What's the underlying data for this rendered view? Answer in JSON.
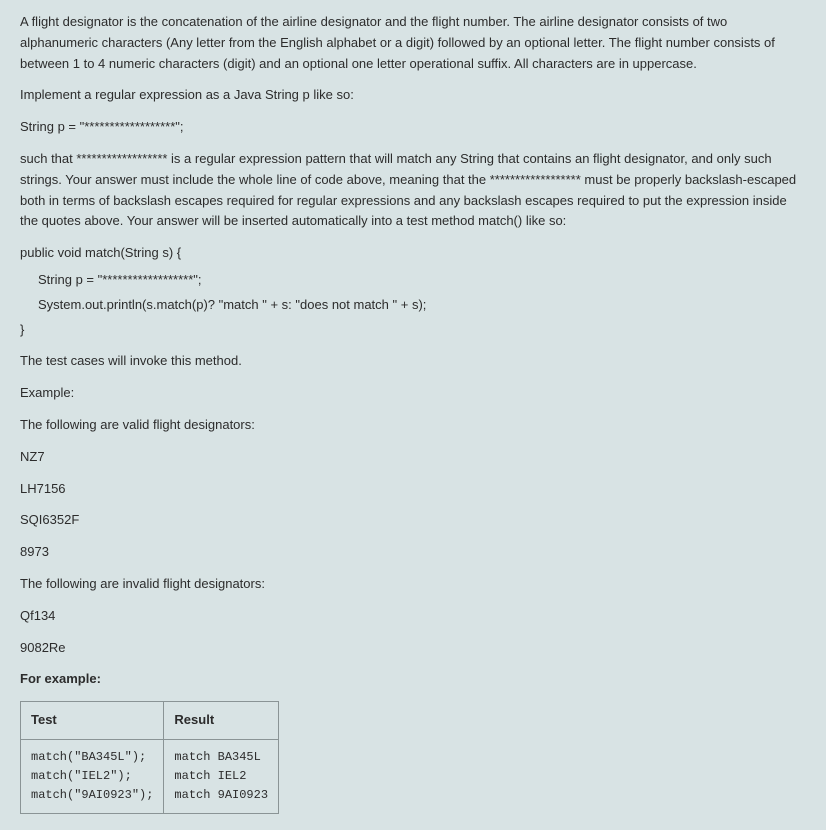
{
  "intro1": "A flight designator is the concatenation of the airline designator and the flight number.  The airline designator consists of two alphanumeric characters (Any letter from the English alphabet or a digit) followed by an optional letter.  The flight number consists of between 1 to 4 numeric characters (digit) and an optional one letter operational suffix.  All characters are in uppercase.",
  "intro2": "Implement a regular expression as a Java String p like so:",
  "codeline1": "String p = \"******************\";",
  "suchthat": "such that ****************** is a regular expression pattern that will match any String that contains an flight designator, and only such strings. Your answer must include the whole line of code above, meaning that the ****************** must be properly backslash-escaped both in terms of backslash escapes required for regular expressions and any backslash escapes required to put the expression inside the quotes above. Your answer will be inserted automatically into a test method match() like so:",
  "method_open": "public void match(String s) {",
  "method_l1": "String p = \"******************\";",
  "method_l2": "System.out.println(s.match(p)? \"match \" + s: \"does not match \" + s);",
  "method_close": "}",
  "testcases_line": "The test cases will invoke this method.",
  "example_label": "Example:",
  "valid_label": "The following are valid flight designators:",
  "valid1": "NZ7",
  "valid2": "LH7156",
  "valid3": "SQI6352F",
  "valid4": "8973",
  "invalid_label": "The following are invalid flight designators:",
  "invalid1": "Qf134",
  "invalid2": "9082Re",
  "for_example": "For example:",
  "table": {
    "headers": {
      "test": "Test",
      "result": "Result"
    },
    "rows": [
      {
        "test": "match(\"BA345L\");",
        "result": "match BA345L"
      },
      {
        "test": "match(\"IEL2\");",
        "result": "match IEL2"
      },
      {
        "test": "match(\"9AI0923\");",
        "result": "match 9AI0923"
      }
    ]
  }
}
